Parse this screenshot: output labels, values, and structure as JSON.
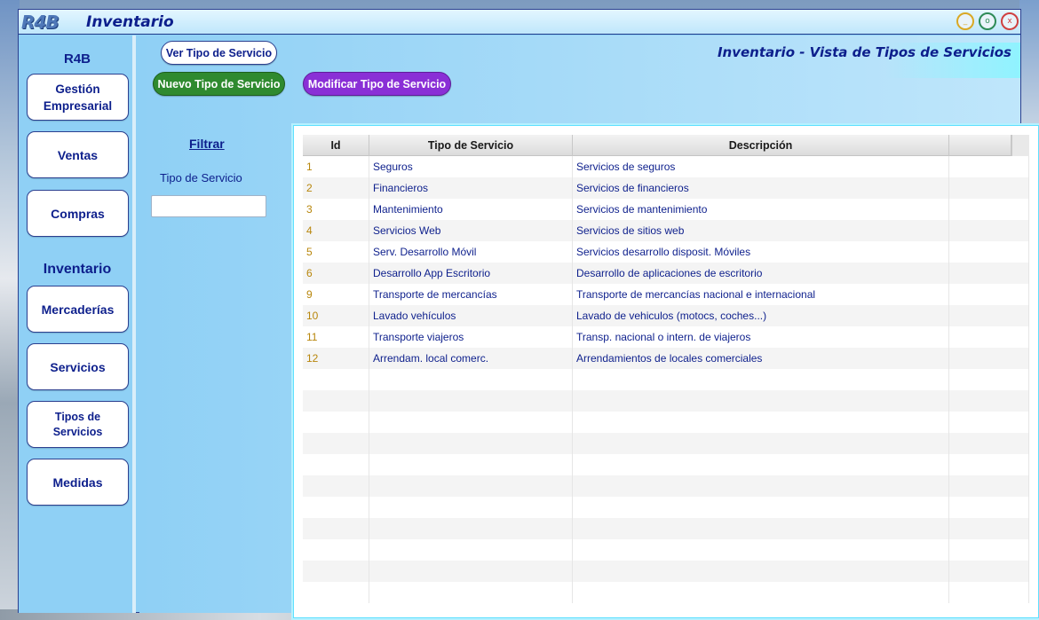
{
  "window": {
    "logo": "R4B",
    "title": "Inventario",
    "min_glyph": "_",
    "max_glyph": "o",
    "close_glyph": "x"
  },
  "sidebar": {
    "section_r4b": "R4B",
    "section_inventario": "Inventario",
    "items": [
      {
        "label": "Gestión Empresarial"
      },
      {
        "label": "Ventas"
      },
      {
        "label": "Compras"
      },
      {
        "label": "Mercaderías"
      },
      {
        "label": "Servicios"
      },
      {
        "label": "Tipos de Servicios"
      },
      {
        "label": "Medidas"
      }
    ]
  },
  "toolbar": {
    "ver_label": "Ver Tipo de Servicio",
    "nuevo_label": "Nuevo Tipo de Servicio",
    "modificar_label": "Modificar Tipo de Servicio",
    "nuevo_color": "#2f8a2f",
    "modificar_color": "#8a2fd6"
  },
  "page_title": "Inventario - Vista de Tipos de Servicios",
  "filter": {
    "title": "Filtrar",
    "label": "Tipo de Servicio",
    "value": ""
  },
  "table": {
    "columns": [
      "Id",
      "Tipo de Servicio",
      "Descripción",
      ""
    ],
    "rows": [
      {
        "id": "1",
        "tipo": "Seguros",
        "descripcion": "Servicios de seguros"
      },
      {
        "id": "2",
        "tipo": "Financieros",
        "descripcion": "Servicios de financieros"
      },
      {
        "id": "3",
        "tipo": "Mantenimiento",
        "descripcion": "Servicios de mantenimiento"
      },
      {
        "id": "4",
        "tipo": "Servicios Web",
        "descripcion": "Servicios de sitios web"
      },
      {
        "id": "5",
        "tipo": "Serv. Desarrollo Móvil",
        "descripcion": "Servicios desarrollo disposit. Móviles"
      },
      {
        "id": "6",
        "tipo": "Desarrollo App Escritorio",
        "descripcion": "Desarrollo de aplicaciones de escritorio"
      },
      {
        "id": "9",
        "tipo": "Transporte de mercancías",
        "descripcion": "Transporte de mercancías nacional e internacional"
      },
      {
        "id": "10",
        "tipo": "Lavado vehículos",
        "descripcion": "Lavado de vehiculos (motocs, coches...)"
      },
      {
        "id": "11",
        "tipo": "Transporte viajeros",
        "descripcion": "Transp. nacional o intern. de viajeros"
      },
      {
        "id": "12",
        "tipo": "Arrendam. local comerc.",
        "descripcion": "Arrendamientos de locales comerciales"
      }
    ]
  }
}
